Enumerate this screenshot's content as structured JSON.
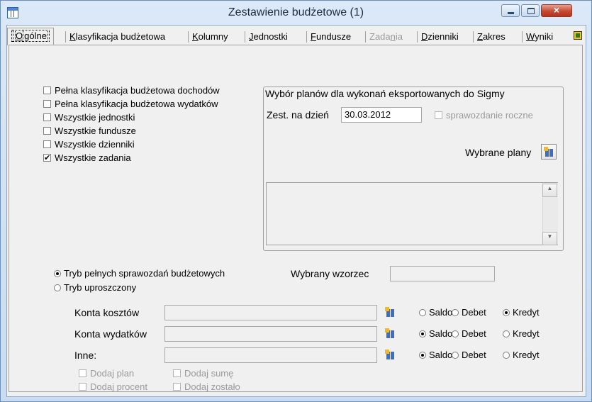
{
  "window": {
    "title": "Zestawienie budżetowe (1)",
    "close_glyph": "×"
  },
  "tabs": [
    {
      "pre": "",
      "key": "O",
      "post": "gólne"
    },
    {
      "pre": "",
      "key": "K",
      "post": "lasyfikacja budżetowa"
    },
    {
      "pre": "",
      "key": "K",
      "post": "olumny"
    },
    {
      "pre": "",
      "key": "J",
      "post": "ednostki"
    },
    {
      "pre": "",
      "key": "F",
      "post": "undusze"
    },
    {
      "pre": "Zada",
      "key": "n",
      "post": "ia"
    },
    {
      "pre": "",
      "key": "D",
      "post": "zienniki"
    },
    {
      "pre": "",
      "key": "Z",
      "post": "akres"
    },
    {
      "pre": "",
      "key": "W",
      "post": "yniki"
    }
  ],
  "options": [
    {
      "label": "Pełna klasyfikacja budżetowa dochodów",
      "checked": false
    },
    {
      "label": "Pełna klasyfikacja budżetowa wydatków",
      "checked": false
    },
    {
      "label": "Wszystkie jednostki",
      "checked": false
    },
    {
      "label": "Wszystkie fundusze",
      "checked": false
    },
    {
      "label": "Wszystkie dzienniki",
      "checked": false
    },
    {
      "label": "Wszystkie zadania",
      "checked": true
    }
  ],
  "sigma": {
    "title": "Wybór planów dla wykonań eksportowanych do Sigmy",
    "date_label": "Zest. na dzień",
    "date_value": "30.03.2012",
    "annual_label": "sprawozdanie roczne",
    "plans_label": "Wybrane plany"
  },
  "mode": {
    "full_label": "Tryb pełnych sprawozdań budżetowych",
    "simple_label": "Tryb uproszczony",
    "template_label": "Wybrany wzorzec",
    "template_value": ""
  },
  "accounts": [
    {
      "label": "Konta kosztów",
      "value": "",
      "selected": "Kredyt"
    },
    {
      "label": "Konta wydatków",
      "value": "",
      "selected": "Saldo"
    },
    {
      "label": "Inne:",
      "value": "",
      "selected": "Saldo"
    }
  ],
  "radio_options": [
    "Saldo",
    "Debet",
    "Kredyt"
  ],
  "extras": {
    "add_plan": "Dodaj plan",
    "add_sum": "Dodaj sumę",
    "add_percent": "Dodaj procent",
    "add_remaining": "Dodaj zostało"
  }
}
